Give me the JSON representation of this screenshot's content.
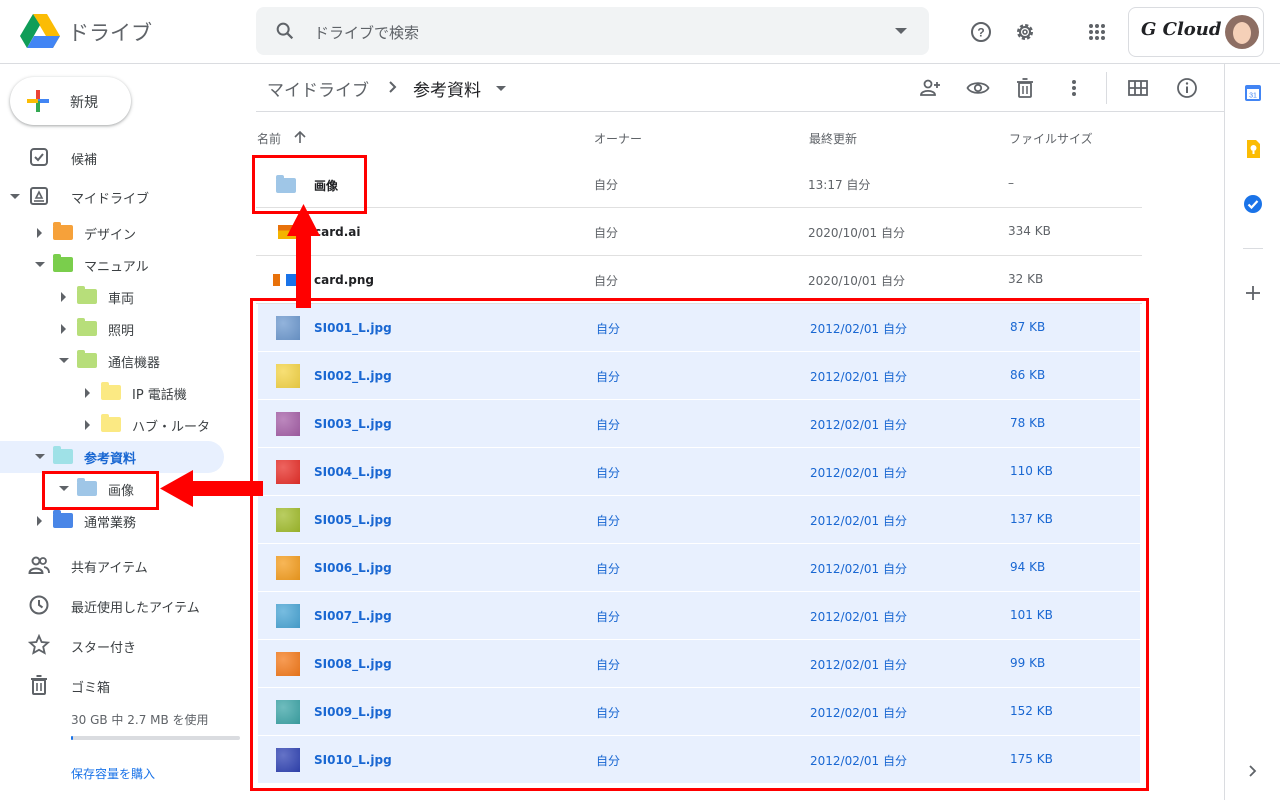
{
  "app": {
    "title": "ドライブ",
    "search_placeholder": "ドライブで検索",
    "account_name": "G Cloud"
  },
  "colors": {
    "accent": "#1a73e8",
    "selected_bg": "#e8f0fe",
    "annotation": "#ff0000"
  },
  "sidebar": {
    "new_label": "新規",
    "nav_top": [
      {
        "label": "候補",
        "icon": "check-box-icon"
      },
      {
        "label": "マイドライブ",
        "icon": "my-drive-icon"
      }
    ],
    "tree": [
      {
        "label": "デザイン",
        "level": 1,
        "expanded": false,
        "color": "#f6a13a"
      },
      {
        "label": "マニュアル",
        "level": 1,
        "expanded": true,
        "color": "#7ace4c"
      },
      {
        "label": "車両",
        "level": 2,
        "expanded": false,
        "color": "#b7de7a"
      },
      {
        "label": "照明",
        "level": 2,
        "expanded": false,
        "color": "#b7de7a"
      },
      {
        "label": "通信機器",
        "level": 2,
        "expanded": true,
        "color": "#b7de7a"
      },
      {
        "label": "IP 電話機",
        "level": 3,
        "expanded": false,
        "color": "#fbe983"
      },
      {
        "label": "ハブ・ルータ",
        "level": 3,
        "expanded": false,
        "color": "#fbe983"
      },
      {
        "label": "参考資料",
        "level": 1,
        "expanded": true,
        "color": "#9fe1e7",
        "selected": true
      },
      {
        "label": "画像",
        "level": 2,
        "expanded": true,
        "color": "#9fc6e7"
      },
      {
        "label": "通常業務",
        "level": 1,
        "expanded": false,
        "color": "#4986e7"
      }
    ],
    "nav_bottom": [
      {
        "label": "共有アイテム",
        "icon": "shared-icon"
      },
      {
        "label": "最近使用したアイテム",
        "icon": "clock-icon"
      },
      {
        "label": "スター付き",
        "icon": "star-icon"
      },
      {
        "label": "ゴミ箱",
        "icon": "trash-icon"
      }
    ],
    "storage_text": "30 GB 中 2.7 MB を使用",
    "storage_used_fraction": 0.01,
    "buy_storage": "保存容量を購入"
  },
  "breadcrumb": {
    "root": "マイドライブ",
    "current": "参考資料"
  },
  "columns": {
    "name": "名前",
    "owner": "オーナー",
    "modified": "最終更新",
    "size": "ファイルサイズ"
  },
  "files": [
    {
      "name": "画像",
      "owner": "自分",
      "modified": "13:17 自分",
      "size": "–",
      "kind": "folder",
      "color": "#9fc6e7"
    },
    {
      "name": "card.ai",
      "owner": "自分",
      "modified": "2020/10/01 自分",
      "size": "334 KB",
      "kind": "ai",
      "color": "#f4b400"
    },
    {
      "name": "card.png",
      "owner": "自分",
      "modified": "2020/10/01 自分",
      "size": "32 KB",
      "kind": "png",
      "color": "#e8710a"
    },
    {
      "name": "SI001_L.jpg",
      "owner": "自分",
      "modified": "2012/02/01 自分",
      "size": "87 KB",
      "kind": "jpg",
      "color": "#6e9ad0",
      "selected": true
    },
    {
      "name": "SI002_L.jpg",
      "owner": "自分",
      "modified": "2012/02/01 自分",
      "size": "86 KB",
      "kind": "jpg",
      "color": "#f5d547",
      "selected": true
    },
    {
      "name": "SI003_L.jpg",
      "owner": "自分",
      "modified": "2012/02/01 自分",
      "size": "78 KB",
      "kind": "jpg",
      "color": "#a660a8",
      "selected": true
    },
    {
      "name": "SI004_L.jpg",
      "owner": "自分",
      "modified": "2012/02/01 自分",
      "size": "110 KB",
      "kind": "jpg",
      "color": "#e8302a",
      "selected": true
    },
    {
      "name": "SI005_L.jpg",
      "owner": "自分",
      "modified": "2012/02/01 自分",
      "size": "137 KB",
      "kind": "jpg",
      "color": "#a2bd2d",
      "selected": true
    },
    {
      "name": "SI006_L.jpg",
      "owner": "自分",
      "modified": "2012/02/01 自分",
      "size": "94 KB",
      "kind": "jpg",
      "color": "#f59e1f",
      "selected": true
    },
    {
      "name": "SI007_L.jpg",
      "owner": "自分",
      "modified": "2012/02/01 自分",
      "size": "101 KB",
      "kind": "jpg",
      "color": "#4aa6d6",
      "selected": true
    },
    {
      "name": "SI008_L.jpg",
      "owner": "自分",
      "modified": "2012/02/01 自分",
      "size": "99 KB",
      "kind": "jpg",
      "color": "#f57b1c",
      "selected": true
    },
    {
      "name": "SI009_L.jpg",
      "owner": "自分",
      "modified": "2012/02/01 自分",
      "size": "152 KB",
      "kind": "jpg",
      "color": "#3ea6a8",
      "selected": true
    },
    {
      "name": "SI010_L.jpg",
      "owner": "自分",
      "modified": "2012/02/01 自分",
      "size": "175 KB",
      "kind": "jpg",
      "color": "#3144b4",
      "selected": true
    }
  ]
}
